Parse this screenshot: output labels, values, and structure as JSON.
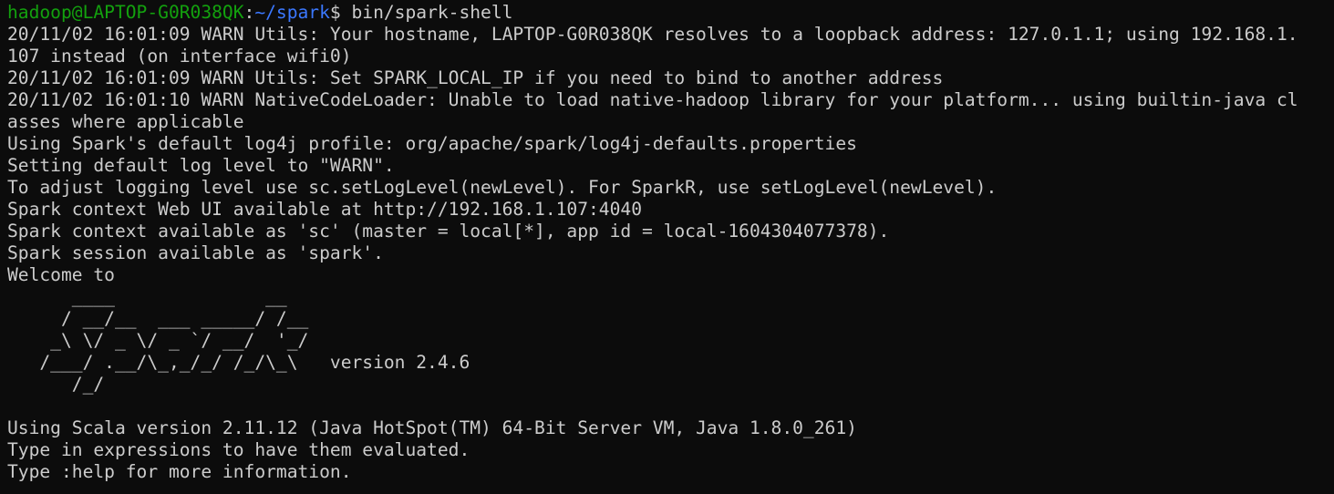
{
  "terminal": {
    "prompt": {
      "user_host": "hadoop@LAPTOP-G0R038QK",
      "separator": ":",
      "path": "~/spark",
      "symbol": "$ ",
      "command": "bin/spark-shell"
    },
    "output_lines": [
      "20/11/02 16:01:09 WARN Utils: Your hostname, LAPTOP-G0R038QK resolves to a loopback address: 127.0.1.1; using 192.168.1.",
      "107 instead (on interface wifi0)",
      "20/11/02 16:01:09 WARN Utils: Set SPARK_LOCAL_IP if you need to bind to another address",
      "20/11/02 16:01:10 WARN NativeCodeLoader: Unable to load native-hadoop library for your platform... using builtin-java cl",
      "asses where applicable",
      "Using Spark's default log4j profile: org/apache/spark/log4j-defaults.properties",
      "Setting default log level to \"WARN\".",
      "To adjust logging level use sc.setLogLevel(newLevel). For SparkR, use setLogLevel(newLevel).",
      "Spark context Web UI available at http://192.168.1.107:4040",
      "Spark context available as 'sc' (master = local[*], app id = local-1604304077378).",
      "Spark session available as 'spark'.",
      "Welcome to",
      "      ____              __",
      "     / __/__  ___ _____/ /__",
      "    _\\ \\/ _ \\/ _ `/ __/  '_/",
      "   /___/ .__/\\_,_/_/ /_/\\_\\   version 2.4.6",
      "      /_/",
      "",
      "Using Scala version 2.11.12 (Java HotSpot(TM) 64-Bit Server VM, Java 1.8.0_261)",
      "Type in expressions to have them evaluated.",
      "Type :help for more information."
    ]
  }
}
